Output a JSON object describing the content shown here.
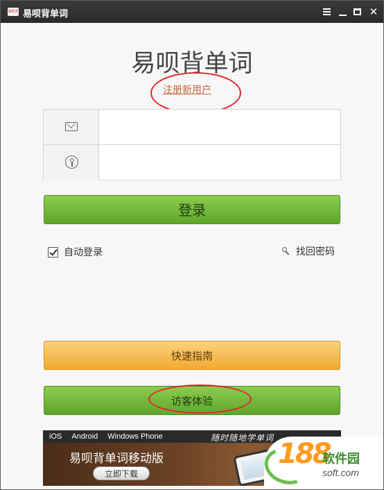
{
  "window": {
    "title": "易呗背单词",
    "icon_text": "易呗背"
  },
  "login": {
    "app_title": "易呗背单词",
    "register_link": "注册新用户",
    "email_placeholder": "",
    "password_placeholder": "",
    "login_button": "登录",
    "auto_login_label": "自动登录",
    "auto_login_checked": true,
    "forgot_password": "找回密码",
    "guide_button": "快速指南",
    "guest_button": "访客体验"
  },
  "banner": {
    "platforms": [
      "iOS",
      "Android",
      "Windows Phone"
    ],
    "slogan": "随时随地学单词",
    "title": "易呗背单词移动版",
    "download_button": "立即下载"
  },
  "watermark": {
    "number": "188",
    "name": "软件园",
    "domain": "soft.com"
  },
  "colors": {
    "accent_green": "#6ab535",
    "accent_orange": "#f5b443",
    "annotation_red": "#e4242b",
    "link_orange": "#c0663c"
  }
}
